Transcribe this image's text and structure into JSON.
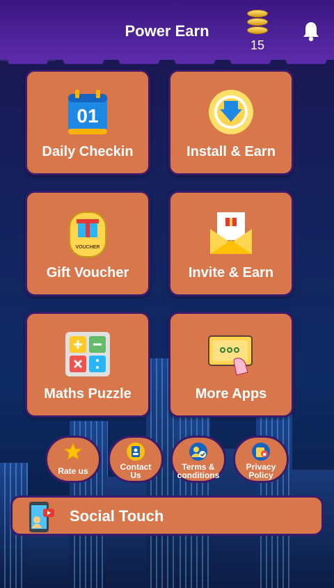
{
  "app": {
    "title": "Power Earn"
  },
  "wallet": {
    "coins": "15"
  },
  "colors": {
    "card": "#d8774b",
    "card_border": "#3a1a6a",
    "header": "#4a2096"
  },
  "grid": [
    {
      "label": "Daily Checkin",
      "icon": "calendar-icon"
    },
    {
      "label": "Install & Earn",
      "icon": "download-icon"
    },
    {
      "label": "Gift Voucher",
      "icon": "gift-voucher-icon"
    },
    {
      "label": "Invite & Earn",
      "icon": "envelope-gift-icon"
    },
    {
      "label": "Maths Puzzle",
      "icon": "calculator-icon"
    },
    {
      "label": "More Apps",
      "icon": "apps-screen-icon"
    }
  ],
  "calendar_icon_text": "01",
  "voucher_icon_text": "VOUCHER",
  "quick_links": [
    {
      "label": "Rate us",
      "icon": "star-icon"
    },
    {
      "label": "Contact Us",
      "icon": "contact-book-icon"
    },
    {
      "label": "Terms & conditions",
      "icon": "terms-icon"
    },
    {
      "label": "Privacy Policy",
      "icon": "privacy-icon"
    }
  ],
  "social": {
    "label": "Social Touch",
    "icon": "social-touch-icon"
  }
}
